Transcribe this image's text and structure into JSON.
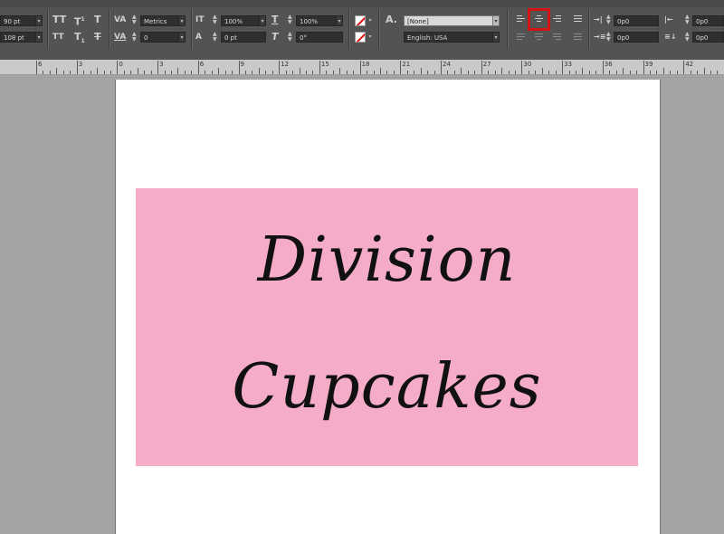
{
  "toolbar": {
    "font_size": "90 pt",
    "leading": "108 pt",
    "kerning": "Metrics",
    "tracking": "0",
    "vertical_scale": "100%",
    "horizontal_scale": "100%",
    "baseline_shift": "0 pt",
    "skew": "0°",
    "character_style": "[None]",
    "language": "English: USA",
    "indent_left": "0p0",
    "indent_right": "0p0",
    "indent_first": "0p0",
    "indent_last": "0p0",
    "space_before": "0p0",
    "space_after": "0p0",
    "icons": {
      "all_caps": "TT",
      "superscript": "T",
      "superscript_mark": "1",
      "underline_t": "T",
      "small_caps": "TT",
      "subscript": "T",
      "subscript_mark": "1",
      "strikethrough_t": "T",
      "kerning": "VA",
      "tracking": "VA",
      "vscale": "IT",
      "baseline": "A",
      "hscale": "T",
      "skew": "T",
      "char_style": "A."
    }
  },
  "ruler": {
    "labels": [
      "6",
      "3",
      "0",
      "3",
      "6",
      "9",
      "12",
      "15",
      "18",
      "21",
      "24",
      "27",
      "30",
      "33",
      "36",
      "39",
      "42"
    ]
  },
  "document": {
    "line1": "Division",
    "line2": "Cupcakes",
    "banner_color": "#f4acc9"
  },
  "colors": {
    "highlight": "#d41414"
  }
}
